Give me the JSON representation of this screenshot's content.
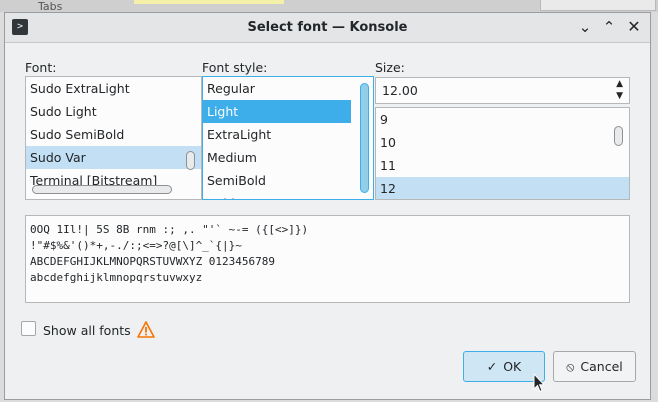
{
  "background": {
    "tab_label": "Tabs"
  },
  "window": {
    "title": "Select font — Konsole"
  },
  "labels": {
    "font": "Font:",
    "style": "Font style:",
    "size": "Size:"
  },
  "font_list": {
    "items": [
      {
        "label": "Sudo ExtraLight"
      },
      {
        "label": "Sudo Light"
      },
      {
        "label": "Sudo SemiBold"
      },
      {
        "label": "Sudo Var"
      },
      {
        "label": "Terminal [Bitstream]"
      }
    ],
    "selected": "Sudo Var"
  },
  "style_list": {
    "items": [
      {
        "label": "Regular"
      },
      {
        "label": "Light"
      },
      {
        "label": "ExtraLight"
      },
      {
        "label": "Medium"
      },
      {
        "label": "SemiBold"
      },
      {
        "label": "Bold"
      }
    ],
    "selected": "Light"
  },
  "size": {
    "value": "12.00",
    "items": [
      {
        "label": "9"
      },
      {
        "label": "10"
      },
      {
        "label": "11"
      },
      {
        "label": "12"
      }
    ],
    "selected": "12"
  },
  "preview": {
    "lines": [
      "0OQ 1Il!| 5S 8B rnm :; ,. \"'` ~-= ({[<>]})",
      "!\"#$%&'()*+,-./:;<=>?@[\\]^_`{|}~",
      "ABCDEFGHIJKLMNOPQRSTUVWXYZ 0123456789",
      "abcdefghijklmnopqrstuvwxyz"
    ]
  },
  "show_all": {
    "label": "Show all fonts",
    "checked": false
  },
  "buttons": {
    "ok": "OK",
    "cancel": "Cancel"
  },
  "colors": {
    "accent": "#3daee9",
    "selection_light": "#c2dff3",
    "warning": "#f67400"
  }
}
